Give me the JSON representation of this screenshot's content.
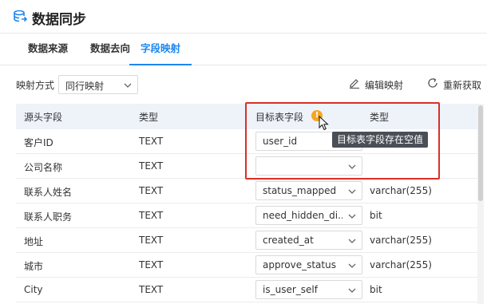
{
  "header": {
    "title": "数据同步",
    "icon": "data-sync-icon"
  },
  "tabs": [
    {
      "label": "数据来源",
      "active": false
    },
    {
      "label": "数据去向",
      "active": false
    },
    {
      "label": "字段映射",
      "active": true
    }
  ],
  "toolbar": {
    "mapping_mode_label": "映射方式",
    "mapping_mode_value": "同行映射",
    "edit_mapping_label": "编辑映射",
    "refetch_label": "重新获取"
  },
  "table": {
    "headers": {
      "source_field": "源头字段",
      "source_type": "类型",
      "target_field": "目标表字段",
      "target_type": "类型"
    },
    "rows": [
      {
        "source_field": "客户ID",
        "source_type": "TEXT",
        "target_field": "user_id",
        "target_type": ""
      },
      {
        "source_field": "公司名称",
        "source_type": "TEXT",
        "target_field": "",
        "target_type": ""
      },
      {
        "source_field": "联系人姓名",
        "source_type": "TEXT",
        "target_field": "status_mapped",
        "target_type": "varchar(255)"
      },
      {
        "source_field": "联系人职务",
        "source_type": "TEXT",
        "target_field": "need_hidden_di...",
        "target_type": "bit"
      },
      {
        "source_field": "地址",
        "source_type": "TEXT",
        "target_field": "created_at",
        "target_type": "varchar(255)"
      },
      {
        "source_field": "城市",
        "source_type": "TEXT",
        "target_field": "approve_status",
        "target_type": "varchar(255)"
      },
      {
        "source_field": "City",
        "source_type": "TEXT",
        "target_field": "is_user_self",
        "target_type": "bit"
      }
    ]
  },
  "warning": {
    "icon_text": "!",
    "tooltip": "目标表字段存在空值"
  },
  "colors": {
    "accent": "#1e87f0",
    "highlight": "#d93025",
    "warning": "#f5a623",
    "header_bg": "#eef3fa"
  }
}
